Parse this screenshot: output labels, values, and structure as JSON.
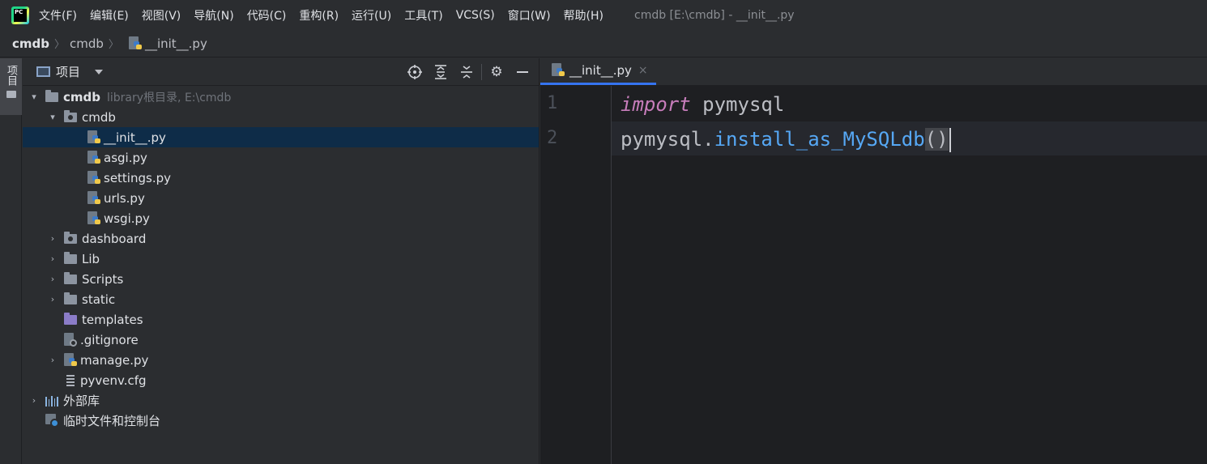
{
  "menu": {
    "items": [
      "文件(F)",
      "编辑(E)",
      "视图(V)",
      "导航(N)",
      "代码(C)",
      "重构(R)",
      "运行(U)",
      "工具(T)",
      "VCS(S)",
      "窗口(W)",
      "帮助(H)"
    ],
    "window_title": "cmdb [E:\\cmdb] - __init__.py",
    "logo_text": "PC"
  },
  "breadcrumb": {
    "items": [
      "cmdb",
      "cmdb",
      "__init__.py"
    ]
  },
  "toolstrip": {
    "tab_label": "项目"
  },
  "project_panel": {
    "title": "项目",
    "tree": [
      {
        "label": "cmdb",
        "hint": "library根目录, E:\\cmdb"
      },
      {
        "label": "cmdb"
      },
      {
        "label": "__init__.py"
      },
      {
        "label": "asgi.py"
      },
      {
        "label": "settings.py"
      },
      {
        "label": "urls.py"
      },
      {
        "label": "wsgi.py"
      },
      {
        "label": "dashboard"
      },
      {
        "label": "Lib"
      },
      {
        "label": "Scripts"
      },
      {
        "label": "static"
      },
      {
        "label": "templates"
      },
      {
        "label": ".gitignore"
      },
      {
        "label": "manage.py"
      },
      {
        "label": "pyvenv.cfg"
      },
      {
        "label": "外部库"
      },
      {
        "label": "临时文件和控制台"
      }
    ]
  },
  "editor": {
    "tab_label": "__init__.py",
    "tab_close": "×",
    "lines": [
      {
        "num": "1",
        "keyword": "import",
        "rest": " pymysql"
      },
      {
        "num": "2",
        "obj": "pymysql.",
        "func": "install_as_MySQLdb",
        "parens": "()"
      }
    ]
  },
  "colors": {
    "accent": "#3574f0",
    "keyword": "#c77dbb",
    "function": "#56a8f5",
    "selection": "#0e2c48"
  }
}
